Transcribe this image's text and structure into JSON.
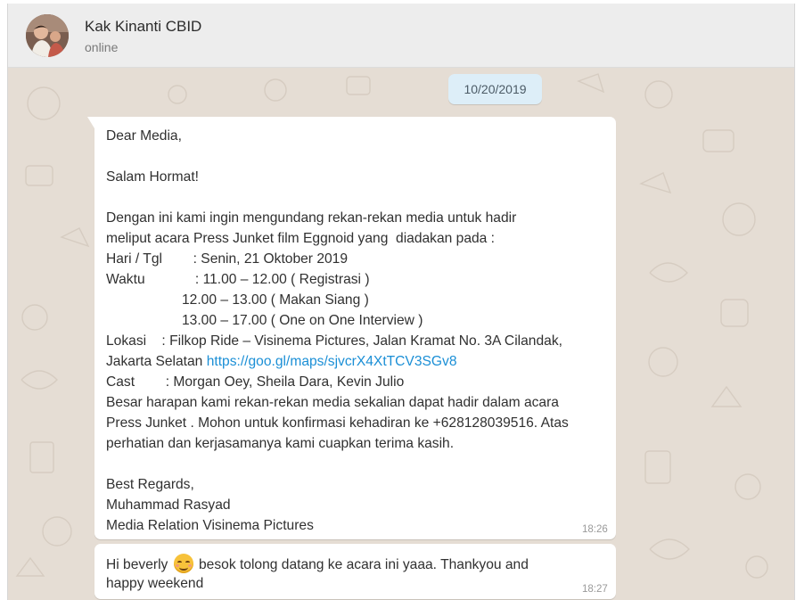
{
  "header": {
    "contact_name": "Kak Kinanti CBID",
    "status": "online",
    "avatar_icon": "profile-photo"
  },
  "chat": {
    "date_separator": "10/20/2019",
    "messages": [
      {
        "lines": [
          "Dear Media,",
          "Salam Hormat!",
          "Dengan ini kami ingin mengundang rekan-rekan media untuk hadir",
          "meliput acara Press Junket film Eggnoid yang  diadakan pada :",
          "Hari / Tgl        : Senin, 21 Oktober 2019",
          "Waktu             : 11.00 – 12.00 ( Registrasi )",
          "12.00 – 13.00 ( Makan Siang )",
          "13.00 – 17.00 ( One on One Interview )",
          "Lokasi    : Filkop Ride – Visinema Pictures, Jalan Kramat No. 3A Cilandak,",
          "Jakarta Selatan ",
          "Cast        : Morgan Oey, Sheila Dara, Kevin Julio",
          "Besar harapan kami rekan-rekan media sekalian dapat hadir dalam acara",
          "Press Junket . Mohon untuk konfirmasi kehadiran ke +628128039516. Atas",
          "perhatian dan kerjasamanya kami cuapkan terima kasih.",
          "Best Regards,",
          "Muhammad Rasyad",
          "Media Relation Visinema Pictures"
        ],
        "link": "https://goo.gl/maps/sjvcrX4XtTCV3SGv8",
        "time": "18:26"
      },
      {
        "text_before_emoji": "Hi beverly ",
        "emoji": "smiling-face-with-smiling-eyes",
        "text_after_emoji": " besok tolong datang ke acara ini yaaa. Thankyou and",
        "line2": "happy weekend",
        "time": "18:27"
      }
    ]
  },
  "colors": {
    "header_bg": "#ededed",
    "chat_bg": "#e5ddd4",
    "date_chip_bg": "#ddeef8",
    "link": "#1b8fd6"
  }
}
